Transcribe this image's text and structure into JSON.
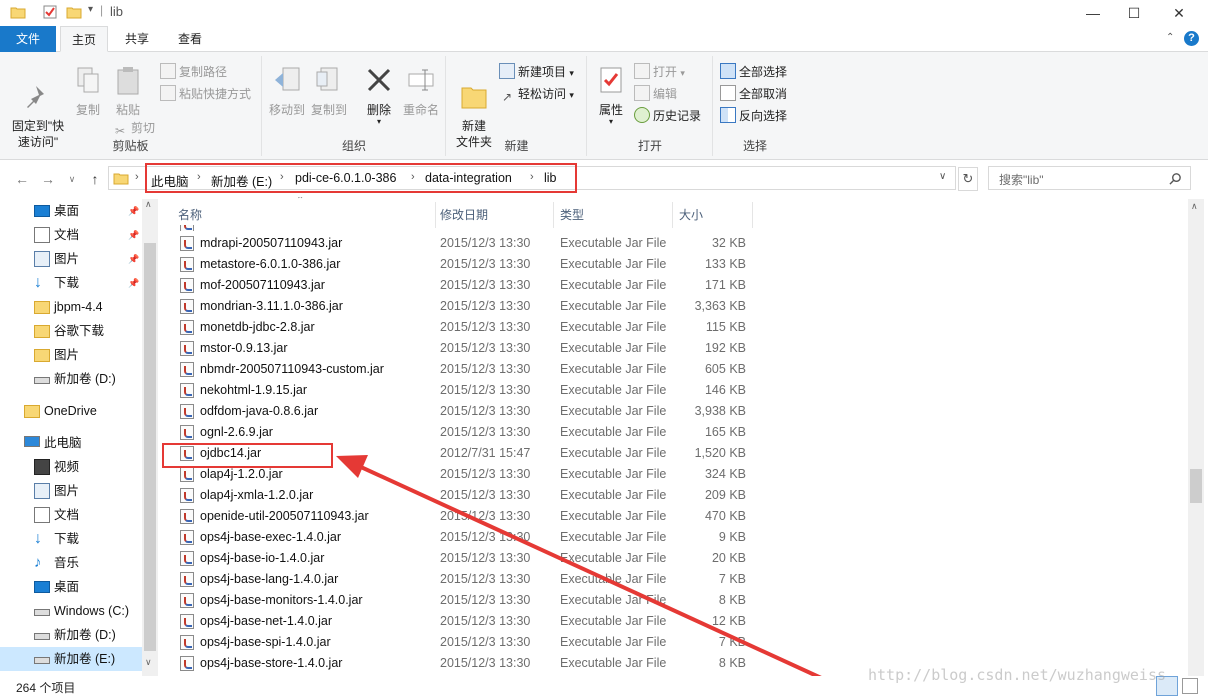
{
  "window": {
    "title": "lib",
    "controls": {
      "minimize": "—",
      "maximize": "☐",
      "close": "✕"
    },
    "help_icon": "?"
  },
  "ribbon_tabs": [
    "文件",
    "主页",
    "共享",
    "查看"
  ],
  "ribbon": {
    "clipboard": {
      "label": "剪贴板",
      "pin": "固定到\"快\n速访问\"",
      "copy": "复制",
      "paste": "粘贴",
      "copy_path": "复制路径",
      "paste_shortcut": "粘贴快捷方式",
      "cut": "剪切"
    },
    "organize": {
      "label": "组织",
      "move_to": "移动到",
      "copy_to": "复制到",
      "delete": "删除",
      "rename": "重命名"
    },
    "new": {
      "label": "新建",
      "new_folder": "新建\n文件夹",
      "new_item": "新建项目",
      "easy_access": "轻松访问"
    },
    "open": {
      "label": "打开",
      "properties": "属性",
      "open": "打开",
      "edit": "编辑",
      "history": "历史记录"
    },
    "select": {
      "label": "选择",
      "select_all": "全部选择",
      "select_none": "全部取消",
      "invert": "反向选择"
    }
  },
  "address": {
    "crumbs": [
      "此电脑",
      "新加卷 (E:)",
      "pdi-ce-6.0.1.0-386",
      "data-integration",
      "lib"
    ],
    "search_placeholder": "搜索\"lib\""
  },
  "nav_pane": [
    {
      "label": "桌面",
      "icon": "desktop-icon",
      "pinned": true
    },
    {
      "label": "文档",
      "icon": "documents-icon",
      "pinned": true
    },
    {
      "label": "图片",
      "icon": "pictures-icon",
      "pinned": true
    },
    {
      "label": "下载",
      "icon": "download-icon",
      "pinned": true
    },
    {
      "label": "jbpm-4.4",
      "icon": "folder-icon",
      "pinned": false
    },
    {
      "label": "谷歌下载",
      "icon": "folder-icon",
      "pinned": false
    },
    {
      "label": "图片",
      "icon": "folder-icon",
      "pinned": false
    },
    {
      "label": "新加卷 (D:)",
      "icon": "drive-icon",
      "pinned": false
    },
    {
      "label": "OneDrive",
      "icon": "folder-icon",
      "pinned": false
    },
    {
      "label": "此电脑",
      "icon": "computer-icon",
      "pinned": false
    },
    {
      "label": "视频",
      "icon": "video-icon",
      "pinned": false
    },
    {
      "label": "图片",
      "icon": "pictures-icon",
      "pinned": false
    },
    {
      "label": "文档",
      "icon": "documents-icon",
      "pinned": false
    },
    {
      "label": "下载",
      "icon": "download-icon",
      "pinned": false
    },
    {
      "label": "音乐",
      "icon": "music-icon",
      "pinned": false
    },
    {
      "label": "桌面",
      "icon": "desktop-icon",
      "pinned": false
    },
    {
      "label": "Windows (C:)",
      "icon": "windows-drive-icon",
      "pinned": false
    },
    {
      "label": "新加卷 (D:)",
      "icon": "drive-icon",
      "pinned": false
    },
    {
      "label": "新加卷 (E:)",
      "icon": "drive-icon",
      "pinned": false,
      "selected": true
    }
  ],
  "columns": {
    "name": "名称",
    "date": "修改日期",
    "type": "类型",
    "size": "大小"
  },
  "files": [
    {
      "name": "mdrapi-200507110943.jar",
      "date": "2015/12/3 13:30",
      "type": "Executable Jar File",
      "size": "32 KB"
    },
    {
      "name": "metastore-6.0.1.0-386.jar",
      "date": "2015/12/3 13:30",
      "type": "Executable Jar File",
      "size": "133 KB"
    },
    {
      "name": "mof-200507110943.jar",
      "date": "2015/12/3 13:30",
      "type": "Executable Jar File",
      "size": "171 KB"
    },
    {
      "name": "mondrian-3.11.1.0-386.jar",
      "date": "2015/12/3 13:30",
      "type": "Executable Jar File",
      "size": "3,363 KB"
    },
    {
      "name": "monetdb-jdbc-2.8.jar",
      "date": "2015/12/3 13:30",
      "type": "Executable Jar File",
      "size": "115 KB"
    },
    {
      "name": "mstor-0.9.13.jar",
      "date": "2015/12/3 13:30",
      "type": "Executable Jar File",
      "size": "192 KB"
    },
    {
      "name": "nbmdr-200507110943-custom.jar",
      "date": "2015/12/3 13:30",
      "type": "Executable Jar File",
      "size": "605 KB"
    },
    {
      "name": "nekohtml-1.9.15.jar",
      "date": "2015/12/3 13:30",
      "type": "Executable Jar File",
      "size": "146 KB"
    },
    {
      "name": "odfdom-java-0.8.6.jar",
      "date": "2015/12/3 13:30",
      "type": "Executable Jar File",
      "size": "3,938 KB"
    },
    {
      "name": "ognl-2.6.9.jar",
      "date": "2015/12/3 13:30",
      "type": "Executable Jar File",
      "size": "165 KB"
    },
    {
      "name": "ojdbc14.jar",
      "date": "2012/7/31 15:47",
      "type": "Executable Jar File",
      "size": "1,520 KB",
      "highlighted": true
    },
    {
      "name": "olap4j-1.2.0.jar",
      "date": "2015/12/3 13:30",
      "type": "Executable Jar File",
      "size": "324 KB"
    },
    {
      "name": "olap4j-xmla-1.2.0.jar",
      "date": "2015/12/3 13:30",
      "type": "Executable Jar File",
      "size": "209 KB"
    },
    {
      "name": "openide-util-200507110943.jar",
      "date": "2015/12/3 13:30",
      "type": "Executable Jar File",
      "size": "470 KB"
    },
    {
      "name": "ops4j-base-exec-1.4.0.jar",
      "date": "2015/12/3 13:30",
      "type": "Executable Jar File",
      "size": "9 KB"
    },
    {
      "name": "ops4j-base-io-1.4.0.jar",
      "date": "2015/12/3 13:30",
      "type": "Executable Jar File",
      "size": "20 KB"
    },
    {
      "name": "ops4j-base-lang-1.4.0.jar",
      "date": "2015/12/3 13:30",
      "type": "Executable Jar File",
      "size": "7 KB"
    },
    {
      "name": "ops4j-base-monitors-1.4.0.jar",
      "date": "2015/12/3 13:30",
      "type": "Executable Jar File",
      "size": "8 KB"
    },
    {
      "name": "ops4j-base-net-1.4.0.jar",
      "date": "2015/12/3 13:30",
      "type": "Executable Jar File",
      "size": "12 KB"
    },
    {
      "name": "ops4j-base-spi-1.4.0.jar",
      "date": "2015/12/3 13:30",
      "type": "Executable Jar File",
      "size": "7 KB"
    },
    {
      "name": "ops4j-base-store-1.4.0.jar",
      "date": "2015/12/3 13:30",
      "type": "Executable Jar File",
      "size": "8 KB"
    }
  ],
  "status": {
    "item_count": "264 个项目"
  },
  "watermark": "http://blog.csdn.net/wuzhangweiss",
  "colors": {
    "accent": "#1979ca",
    "annotation": "#e53935",
    "selection": "#cce8ff"
  }
}
